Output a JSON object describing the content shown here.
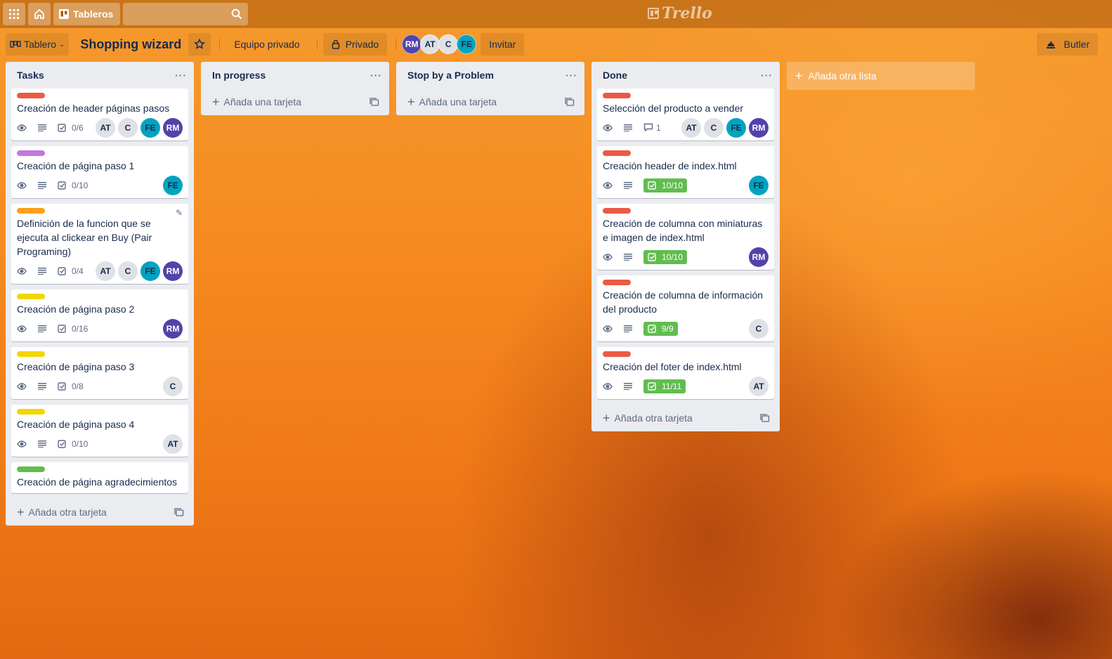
{
  "topbar": {
    "apps_icon": "grid-icon",
    "home_icon": "home-icon",
    "boards_label": "Tableros",
    "search_placeholder": "",
    "logo_text": "Trello"
  },
  "boardbar": {
    "view_label": "Tablero",
    "title": "Shopping wizard",
    "team_label": "Equipo privado",
    "privacy_label": "Privado",
    "invite_label": "Invitar",
    "butler_label": "Butler",
    "members": [
      {
        "initials": "RM",
        "color": "#5243aa"
      },
      {
        "initials": "AT",
        "color": "#dfe1e6"
      },
      {
        "initials": "C",
        "color": "#dfe1e6"
      },
      {
        "initials": "FE",
        "color": "#00a3bf"
      }
    ]
  },
  "colors": {
    "label_red": "#eb5a46",
    "label_purple": "#c377e0",
    "label_orange": "#ff9f1a",
    "label_yellow": "#f2d600",
    "label_green": "#61bd4f"
  },
  "lists": [
    {
      "title": "Tasks",
      "add_label": "Añada otra tarjeta",
      "cards": [
        {
          "label": "#eb5a46",
          "title": "Creación de header páginas pasos",
          "checklist": "0/6",
          "done": false,
          "members": [
            "AT",
            "C",
            "FE",
            "RM"
          ]
        },
        {
          "label": "#c377e0",
          "title": "Creación de página paso 1",
          "checklist": "0/10",
          "done": false,
          "members": [
            "FE"
          ]
        },
        {
          "label": "#ff9f1a",
          "title": "Definición de la funcion que se ejecuta al clickear en Buy (Pair Programing)",
          "checklist": "0/4",
          "done": false,
          "members": [
            "AT",
            "C",
            "FE",
            "RM"
          ]
        },
        {
          "label": "#f2d600",
          "title": "Creación de página paso 2",
          "checklist": "0/16",
          "done": false,
          "members": [
            "RM"
          ]
        },
        {
          "label": "#f2d600",
          "title": "Creación de página paso 3",
          "checklist": "0/8",
          "done": false,
          "members": [
            "C"
          ]
        },
        {
          "label": "#f2d600",
          "title": "Creación de página paso 4",
          "checklist": "0/10",
          "done": false,
          "members": [
            "AT"
          ]
        },
        {
          "label": "#61bd4f",
          "title": "Creación de página agradecimientos",
          "checklist": "",
          "done": false,
          "members": []
        }
      ]
    },
    {
      "title": "In progress",
      "add_label": "Añada una tarjeta",
      "cards": []
    },
    {
      "title": "Stop by a Problem",
      "add_label": "Añada una tarjeta",
      "cards": []
    },
    {
      "title": "Done",
      "add_label": "Añada otra tarjeta",
      "cards": [
        {
          "label": "#eb5a46",
          "title": "Selección del producto a vender",
          "comments": "1",
          "checklist": "",
          "done": false,
          "members": [
            "AT",
            "C",
            "FE",
            "RM"
          ]
        },
        {
          "label": "#eb5a46",
          "title": "Creación header de index.html",
          "checklist": "10/10",
          "done": true,
          "members": [
            "FE"
          ]
        },
        {
          "label": "#eb5a46",
          "title": "Creación de columna con miniaturas e imagen de index.html",
          "checklist": "10/10",
          "done": true,
          "members": [
            "RM"
          ]
        },
        {
          "label": "#eb5a46",
          "title": "Creación de columna de información del producto",
          "checklist": "9/9",
          "done": true,
          "members": [
            "C"
          ]
        },
        {
          "label": "#eb5a46",
          "title": "Creación del foter de index.html",
          "checklist": "11/11",
          "done": true,
          "members": [
            "AT"
          ]
        }
      ]
    }
  ],
  "add_list_label": "Añada otra lista"
}
